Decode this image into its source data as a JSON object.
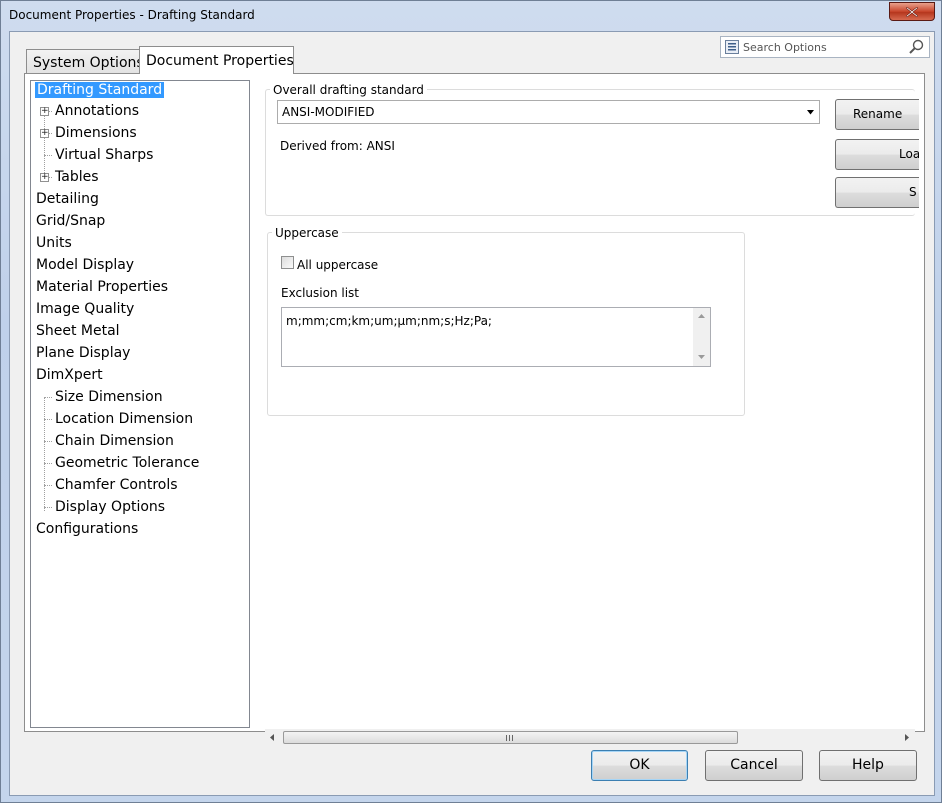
{
  "window": {
    "title": "Document Properties - Drafting Standard"
  },
  "tabs": [
    {
      "label": "System Options"
    },
    {
      "label": "Document Properties"
    }
  ],
  "search": {
    "placeholder": "Search Options"
  },
  "tree": {
    "items": [
      {
        "label": "Drafting Standard"
      },
      {
        "label": "Annotations"
      },
      {
        "label": "Dimensions"
      },
      {
        "label": "Virtual Sharps"
      },
      {
        "label": "Tables"
      },
      {
        "label": "Detailing"
      },
      {
        "label": "Grid/Snap"
      },
      {
        "label": "Units"
      },
      {
        "label": "Model Display"
      },
      {
        "label": "Material Properties"
      },
      {
        "label": "Image Quality"
      },
      {
        "label": "Sheet Metal"
      },
      {
        "label": "Plane Display"
      },
      {
        "label": "DimXpert"
      },
      {
        "label": "Size Dimension"
      },
      {
        "label": "Location Dimension"
      },
      {
        "label": "Chain Dimension"
      },
      {
        "label": "Geometric Tolerance"
      },
      {
        "label": "Chamfer Controls"
      },
      {
        "label": "Display Options"
      },
      {
        "label": "Configurations"
      }
    ]
  },
  "drafting": {
    "group_label": "Overall drafting standard",
    "standard_value": "ANSI-MODIFIED",
    "derived_from": "Derived from: ANSI",
    "rename_label": "Rename",
    "load_label": "Loa",
    "save_label": "S"
  },
  "uppercase": {
    "group_label": "Uppercase",
    "all_uppercase_label": "All uppercase",
    "all_uppercase_checked": false,
    "exclusion_label": "Exclusion list",
    "exclusion_value": "m;mm;cm;km;um;µm;nm;s;Hz;Pa;"
  },
  "footer": {
    "ok_label": "OK",
    "cancel_label": "Cancel",
    "help_label": "Help"
  }
}
